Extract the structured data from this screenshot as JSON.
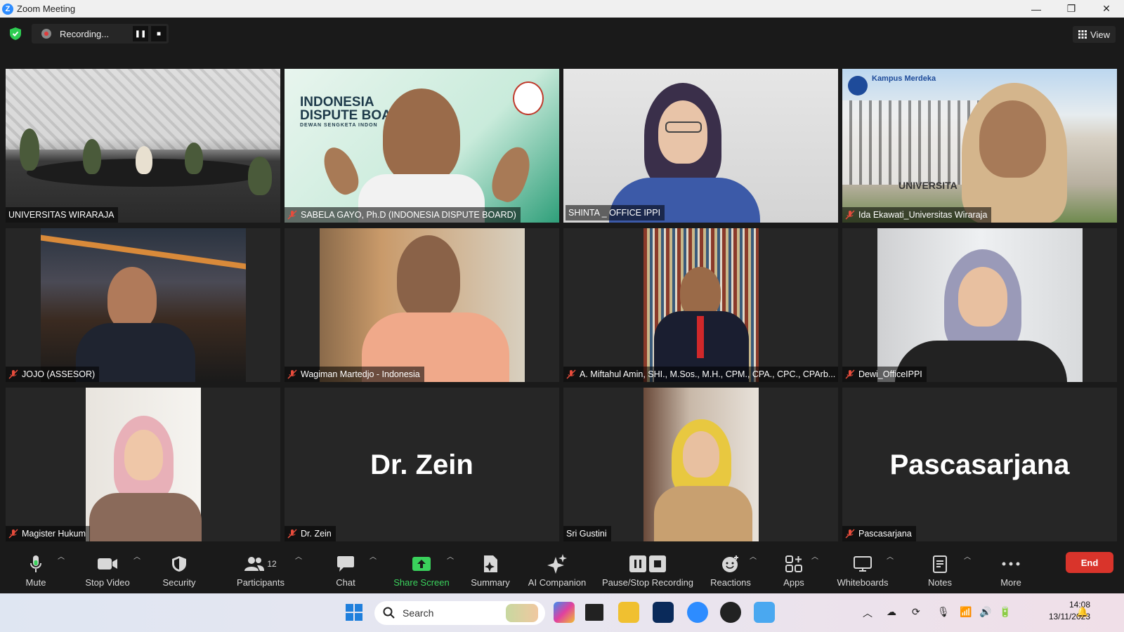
{
  "window": {
    "title": "Zoom Meeting",
    "minimize": "—",
    "restore": "❐",
    "close": "✕"
  },
  "recording": {
    "label": "Recording...",
    "pause": "❚❚",
    "stop": "■"
  },
  "view_label": "View",
  "tiles": [
    {
      "name": "UNIVERSITAS WIRARAJA",
      "muted": false
    },
    {
      "name": "SABELA GAYO, Ph.D (INDONESIA DISPUTE BOARD)",
      "muted": true,
      "bg_text_1": "INDONESIA",
      "bg_text_2": "DISPUTE BOAR",
      "bg_text_3": "DEWAN SENGKETA INDON"
    },
    {
      "name": "SHINTA _ OFFICE IPPI",
      "muted": false,
      "active": true
    },
    {
      "name": "Ida Ekawati_Universitas Wiraraja",
      "muted": true,
      "bg_text_1": "Kampus Merdeka",
      "bg_text_2": "UNIVERSITA"
    },
    {
      "name": "JOJO (ASSESOR)",
      "muted": true
    },
    {
      "name": "Wagiman Martedjo - Indonesia",
      "muted": true
    },
    {
      "name": "A. Miftahul Amin, SHI., M.Sos., M.H., CPM., CPA., CPC., CPArb...",
      "muted": true
    },
    {
      "name": "Dewi_OfficeIPPI",
      "muted": true
    },
    {
      "name": "Magister Hukum",
      "muted": true
    },
    {
      "name": "Dr. Zein",
      "muted": true,
      "display": "Dr. Zein"
    },
    {
      "name": "Sri Gustini",
      "muted": false
    },
    {
      "name": "Pascasarjana",
      "muted": true,
      "display": "Pascasarjana"
    }
  ],
  "toolbar": {
    "mute": "Mute",
    "stop_video": "Stop Video",
    "security": "Security",
    "participants": "Participants",
    "participants_count": "12",
    "chat": "Chat",
    "share_screen": "Share Screen",
    "summary": "Summary",
    "ai_companion": "AI Companion",
    "pause_stop_recording": "Pause/Stop Recording",
    "reactions": "Reactions",
    "apps": "Apps",
    "whiteboards": "Whiteboards",
    "notes": "Notes",
    "more": "More",
    "end": "End"
  },
  "taskbar": {
    "search_placeholder": "Search",
    "time": "14:08",
    "date": "13/11/2023"
  },
  "colors": {
    "active_speaker": "#d5e36b",
    "share_green": "#3ad15c",
    "end_red": "#d9342b"
  }
}
